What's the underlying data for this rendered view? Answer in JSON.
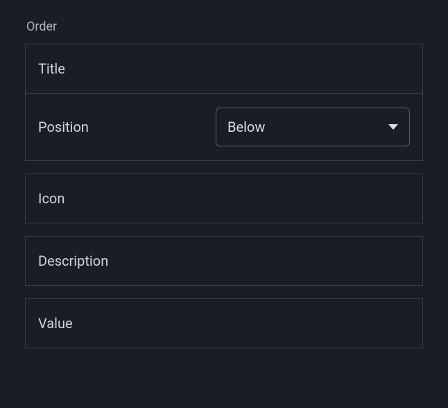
{
  "section": {
    "label": "Order"
  },
  "rows": {
    "title": {
      "label": "Title"
    },
    "position": {
      "label": "Position",
      "value": "Below"
    },
    "icon": {
      "label": "Icon"
    },
    "description": {
      "label": "Description"
    },
    "value": {
      "label": "Value"
    }
  }
}
